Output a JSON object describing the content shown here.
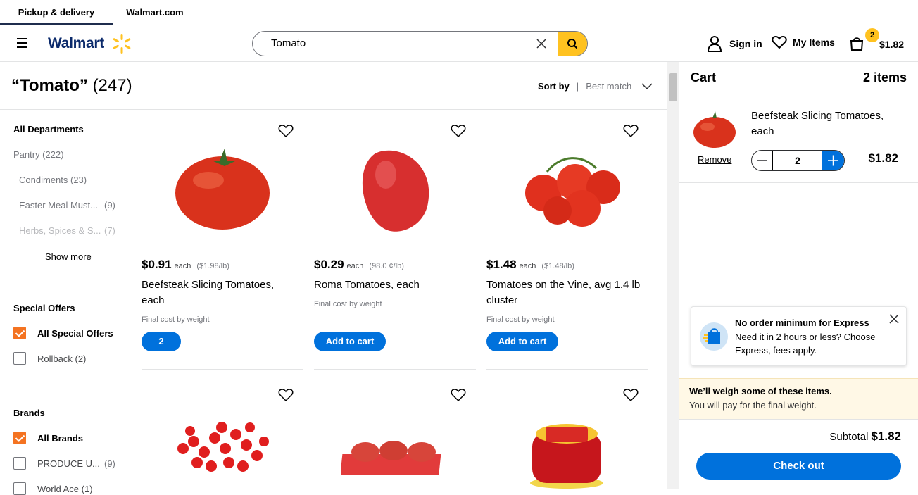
{
  "tabs": [
    "Pickup & delivery",
    "Walmart.com"
  ],
  "header": {
    "logo": "Walmart",
    "search_value": "Tomato",
    "sign_in": "Sign in",
    "my_items": "My Items",
    "cart_count": "2",
    "cart_total": "$1.82"
  },
  "results": {
    "query": "“Tomato”",
    "count": "(247)",
    "sort_label": "Sort by",
    "sort_value": "Best match"
  },
  "sidebar": {
    "departments_title": "All Departments",
    "categories": [
      {
        "label": "Pantry (222)"
      },
      {
        "label": "Condiments (23)"
      },
      {
        "label": "Easter Meal Must...",
        "count": "(9)"
      },
      {
        "label": "Herbs, Spices & S...",
        "count": "(7)"
      }
    ],
    "show_more": "Show more",
    "special_offers_title": "Special Offers",
    "special_offers": [
      {
        "label": "All Special Offers",
        "checked": true
      },
      {
        "label": "Rollback",
        "count": "(2)",
        "checked": false
      }
    ],
    "brands_title": "Brands",
    "brands": [
      {
        "label": "All Brands",
        "checked": true
      },
      {
        "label": "PRODUCE U...",
        "count": "(9)",
        "checked": false
      },
      {
        "label": "World Ace",
        "count": "(1)",
        "checked": false
      }
    ]
  },
  "products": [
    {
      "price": "$0.91",
      "each": "each",
      "unit": "($1.98/lb)",
      "name": "Beefsteak Slicing Tomatoes, each",
      "note": "Final cost by weight",
      "button": "2"
    },
    {
      "price": "$0.29",
      "each": "each",
      "unit": "(98.0 ¢/lb)",
      "name": "Roma Tomatoes, each",
      "note": "Final cost by weight",
      "button": "Add to cart"
    },
    {
      "price": "$1.48",
      "each": "each",
      "unit": "($1.48/lb)",
      "name": "Tomatoes on the Vine, avg 1.4 lb cluster",
      "note": "Final cost by weight",
      "button": "Add to cart"
    }
  ],
  "cart": {
    "title": "Cart",
    "items_count": "2 items",
    "item_name": "Beefsteak Slicing Tomatoes, each",
    "remove": "Remove",
    "qty": "2",
    "item_price": "$1.82",
    "express_title": "No order minimum for Express",
    "express_desc": "Need it in 2 hours or less? Choose Express, fees apply.",
    "weigh_title": "We’ll weigh some of these items.",
    "weigh_desc": "You will pay for the final weight.",
    "subtotal_label": "Subtotal",
    "subtotal_value": "$1.82",
    "checkout": "Check out"
  },
  "colors": {
    "brand_blue": "#0071dc",
    "spark_yellow": "#ffc220",
    "checkbox_orange": "#f47321"
  }
}
